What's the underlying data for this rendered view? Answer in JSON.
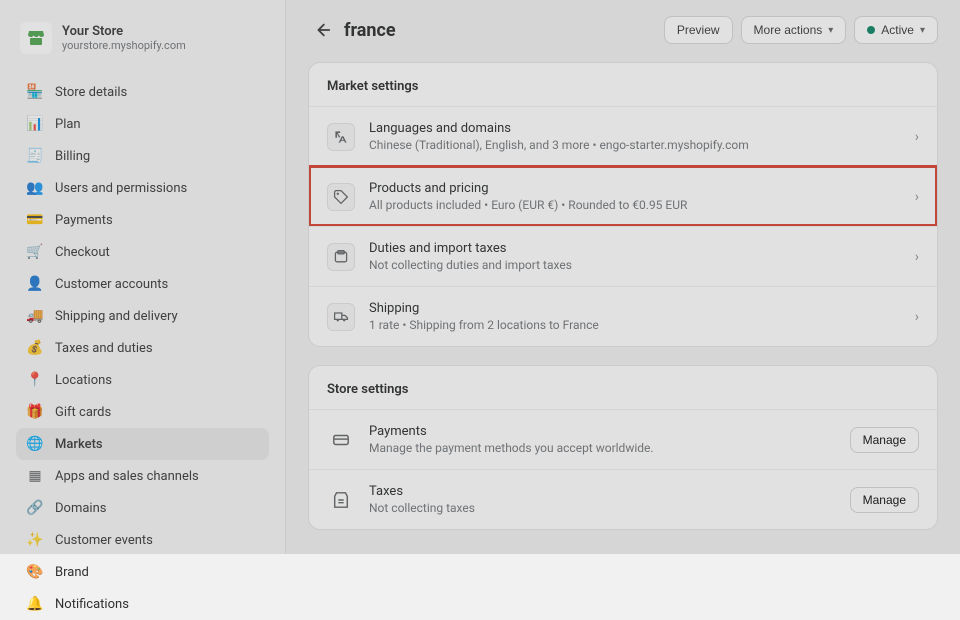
{
  "store": {
    "name": "Your Store",
    "url": "yourstore.myshopify.com"
  },
  "sidebar": {
    "items": [
      {
        "label": "Store details"
      },
      {
        "label": "Plan"
      },
      {
        "label": "Billing"
      },
      {
        "label": "Users and permissions"
      },
      {
        "label": "Payments"
      },
      {
        "label": "Checkout"
      },
      {
        "label": "Customer accounts"
      },
      {
        "label": "Shipping and delivery"
      },
      {
        "label": "Taxes and duties"
      },
      {
        "label": "Locations"
      },
      {
        "label": "Gift cards"
      },
      {
        "label": "Markets"
      },
      {
        "label": "Apps and sales channels"
      },
      {
        "label": "Domains"
      },
      {
        "label": "Customer events"
      },
      {
        "label": "Brand"
      },
      {
        "label": "Notifications"
      }
    ]
  },
  "header": {
    "title": "france",
    "preview": "Preview",
    "more": "More actions",
    "status": "Active"
  },
  "market_settings": {
    "title": "Market settings",
    "rows": [
      {
        "title": "Languages and domains",
        "sub": "Chinese (Traditional), English, and 3 more • engo-starter.myshopify.com"
      },
      {
        "title": "Products and pricing",
        "sub": "All products included • Euro (EUR €) • Rounded to €0.95 EUR"
      },
      {
        "title": "Duties and import taxes",
        "sub": "Not collecting duties and import taxes"
      },
      {
        "title": "Shipping",
        "sub": "1 rate • Shipping from 2 locations to France"
      }
    ]
  },
  "store_settings": {
    "title": "Store settings",
    "rows": [
      {
        "title": "Payments",
        "sub": "Manage the payment methods you accept worldwide."
      },
      {
        "title": "Taxes",
        "sub": "Not collecting taxes"
      }
    ],
    "manage": "Manage"
  }
}
